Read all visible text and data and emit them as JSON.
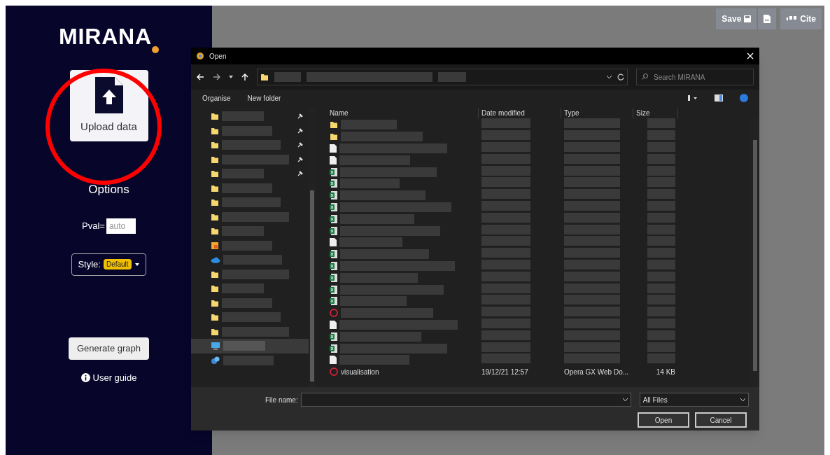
{
  "sidebar": {
    "logo": "MIRANA",
    "upload_button": "Upload data",
    "options_heading": "Options",
    "pval": {
      "label": "Pval=",
      "placeholder": "auto"
    },
    "style": {
      "label": "Style:",
      "value": "Default"
    },
    "generate_button": "Generate graph",
    "user_guide": "User guide"
  },
  "toolbar": {
    "save": "Save",
    "cite": "Cite"
  },
  "dialog": {
    "title": "Open",
    "search": {
      "placeholder": "Search MIRANA"
    },
    "commands": [
      "Organise",
      "New folder"
    ],
    "nav_items": [
      {
        "kind": "folder",
        "pinned": true
      },
      {
        "kind": "folder",
        "pinned": true
      },
      {
        "kind": "folder",
        "pinned": true
      },
      {
        "kind": "folder",
        "pinned": true
      },
      {
        "kind": "folder",
        "pinned": true
      },
      {
        "kind": "folder",
        "pinned": false
      },
      {
        "kind": "folder",
        "pinned": false
      },
      {
        "kind": "folder",
        "pinned": false
      },
      {
        "kind": "folder",
        "pinned": false
      },
      {
        "kind": "library",
        "pinned": false
      },
      {
        "kind": "cloud",
        "pinned": false
      },
      {
        "kind": "folder",
        "pinned": false
      },
      {
        "kind": "folder",
        "pinned": false
      },
      {
        "kind": "folder",
        "pinned": false
      },
      {
        "kind": "folder",
        "pinned": false
      },
      {
        "kind": "folder",
        "pinned": false
      },
      {
        "kind": "computer",
        "pinned": false,
        "selected": true
      },
      {
        "kind": "network",
        "pinned": false
      }
    ],
    "columns": [
      "Name",
      "Date modified",
      "Type",
      "Size"
    ],
    "rows": [
      {
        "kind": "folder"
      },
      {
        "kind": "folder"
      },
      {
        "kind": "file"
      },
      {
        "kind": "file"
      },
      {
        "kind": "sheet"
      },
      {
        "kind": "sheet"
      },
      {
        "kind": "sheet"
      },
      {
        "kind": "sheet"
      },
      {
        "kind": "sheet"
      },
      {
        "kind": "sheet"
      },
      {
        "kind": "file"
      },
      {
        "kind": "sheet"
      },
      {
        "kind": "sheet"
      },
      {
        "kind": "sheet"
      },
      {
        "kind": "sheet"
      },
      {
        "kind": "sheet"
      },
      {
        "kind": "web"
      },
      {
        "kind": "file"
      },
      {
        "kind": "sheet"
      },
      {
        "kind": "sheet"
      },
      {
        "kind": "file"
      },
      {
        "kind": "web",
        "name": "visualisation",
        "date": "19/12/21 12:57",
        "type": "Opera GX Web Do...",
        "size": "14 KB"
      }
    ],
    "file_name_label": "File name:",
    "file_type": "All Files",
    "buttons": [
      "Open",
      "Cancel"
    ]
  }
}
